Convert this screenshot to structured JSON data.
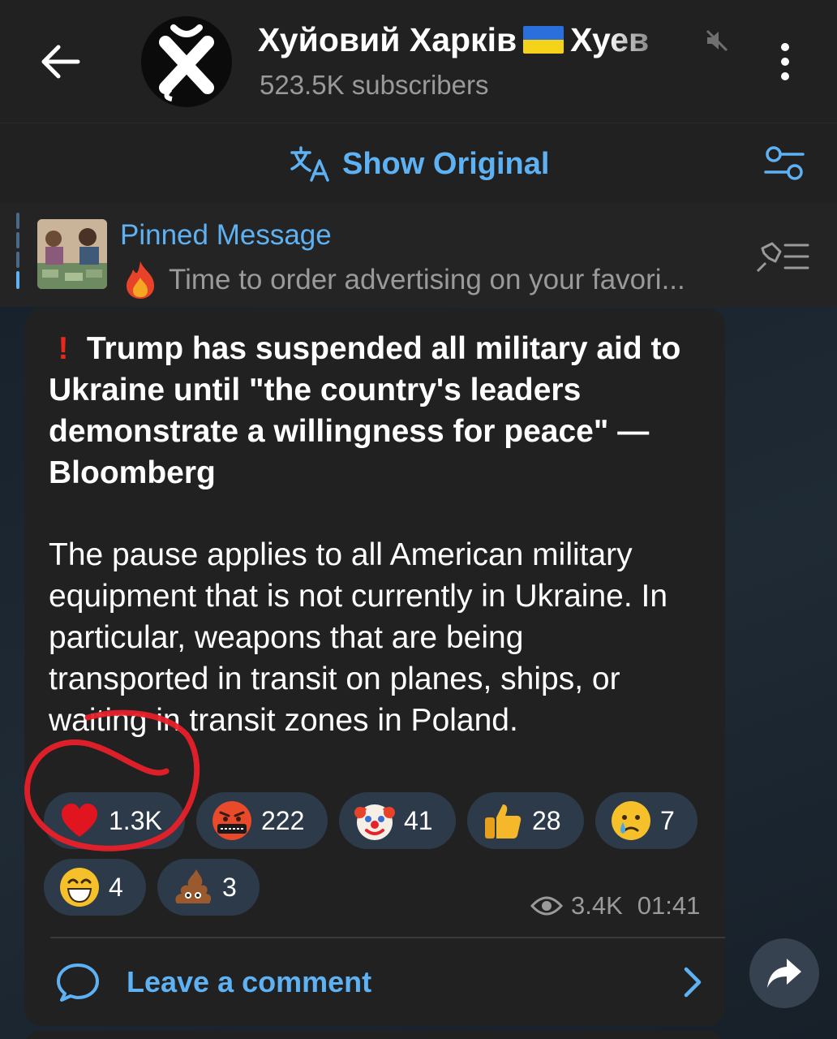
{
  "header": {
    "title": "Хуйовий Харків",
    "title_suffix": "Хуев",
    "subscribers": "523.5K subscribers"
  },
  "translate_bar": {
    "show_original_label": "Show Original"
  },
  "pinned": {
    "title": "Pinned Message",
    "text": "Time to order advertising on your favori..."
  },
  "message": {
    "headline": "Trump has suspended all military aid to Ukraine until \"the country's leaders demonstrate a willingness for peace\" — Bloomberg",
    "body": "The pause applies to all American military equipment that is not currently in Ukraine. In particular, weapons that are being transported in transit on planes, ships, or waiting in transit zones in Poland.",
    "reactions": [
      {
        "emoji": "heart-emoji",
        "count": "1.3K"
      },
      {
        "emoji": "cursing-face-emoji",
        "count": "222"
      },
      {
        "emoji": "clown-face-emoji",
        "count": "41"
      },
      {
        "emoji": "thumbs-up-emoji",
        "count": "28"
      },
      {
        "emoji": "crying-face-emoji",
        "count": "7"
      },
      {
        "emoji": "grinning-face-emoji",
        "count": "4"
      },
      {
        "emoji": "pile-of-poo-emoji",
        "count": "3"
      }
    ],
    "views": "3.4K",
    "time": "01:41",
    "comment_label": "Leave a comment"
  },
  "colors": {
    "accent": "#5eb2f3",
    "header_bg": "#212121",
    "bubble_bg": "#212121",
    "reaction_bg": "#2c3a49",
    "annotation_red": "#e8202a"
  }
}
